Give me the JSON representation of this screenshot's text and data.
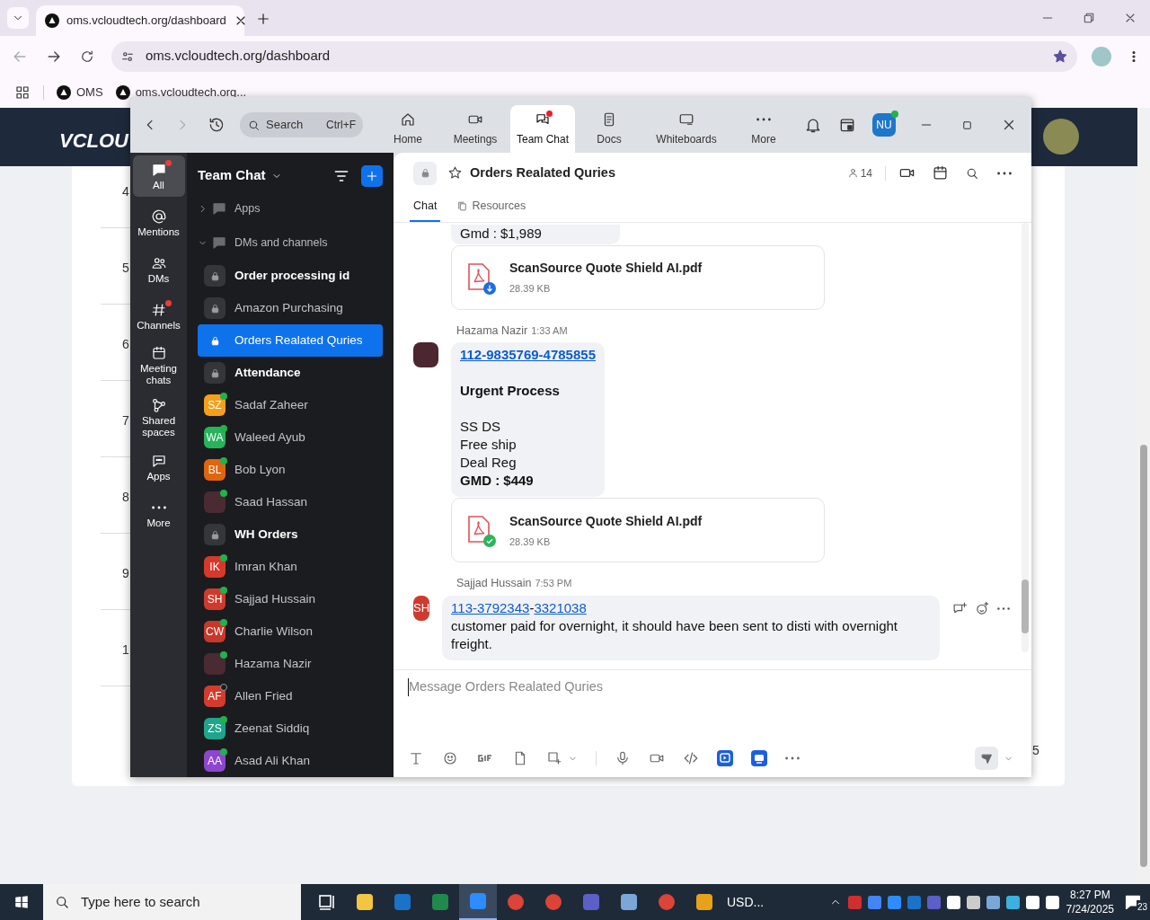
{
  "browser": {
    "tabs": [
      {
        "title": "oms.vcloudtech.org/dashboard",
        "selected": true
      }
    ],
    "address": "oms.vcloudtech.org/dashboard",
    "bookmarks": [
      "OMS",
      "oms.vcloudtech.org..."
    ]
  },
  "page": {
    "logo": "VCLOU",
    "row_numbers": [
      "4",
      "5",
      "6",
      "7",
      "8",
      "9",
      "1"
    ],
    "corner_text": "5"
  },
  "zoom": {
    "search": {
      "placeholder": "Search",
      "shortcut": "Ctrl+F"
    },
    "nav_tabs": [
      {
        "label": "Home",
        "selected": false,
        "badge": false
      },
      {
        "label": "Meetings",
        "selected": false,
        "badge": false
      },
      {
        "label": "Team Chat",
        "selected": true,
        "badge": true
      },
      {
        "label": "Docs",
        "selected": false,
        "badge": false
      },
      {
        "label": "Whiteboards",
        "selected": false,
        "badge": false
      },
      {
        "label": "More",
        "selected": false,
        "badge": false
      }
    ],
    "profile_initials": "NU",
    "rail": [
      {
        "label": "All",
        "selected": true,
        "badge": true
      },
      {
        "label": "Mentions",
        "selected": false,
        "badge": false
      },
      {
        "label": "DMs",
        "selected": false,
        "badge": false
      },
      {
        "label": "Channels",
        "selected": false,
        "badge": true
      },
      {
        "label": "Meeting chats",
        "selected": false,
        "badge": false
      },
      {
        "label": "Shared spaces",
        "selected": false,
        "badge": false
      },
      {
        "label": "Apps",
        "selected": false,
        "badge": false
      },
      {
        "label": "More",
        "selected": false,
        "badge": false
      }
    ],
    "sidebar": {
      "title": "Team Chat",
      "sections": [
        {
          "label": "Apps",
          "expanded": false
        },
        {
          "label": "DMs and channels",
          "expanded": true,
          "children": [
            {
              "kind": "channel",
              "name": "Order processing id",
              "unread": true,
              "selected": false
            },
            {
              "kind": "channel",
              "name": "Amazon Purchasing",
              "unread": false,
              "selected": false
            },
            {
              "kind": "channel",
              "name": "Orders Realated Quries",
              "unread": false,
              "selected": true
            },
            {
              "kind": "channel",
              "name": "Attendance",
              "unread": true,
              "selected": false
            },
            {
              "kind": "person",
              "name": "Sadaf Zaheer",
              "initials": "SZ",
              "color": "#f5a01a",
              "online": true,
              "selected": false
            },
            {
              "kind": "person",
              "name": "Waleed Ayub",
              "initials": "WA",
              "color": "#27b35a",
              "online": true,
              "selected": false
            },
            {
              "kind": "person",
              "name": "Bob Lyon",
              "initials": "BL",
              "color": "#e0650f",
              "online": true,
              "selected": false
            },
            {
              "kind": "photo_person",
              "name": "Saad Hassan",
              "online": true,
              "selected": false
            },
            {
              "kind": "channel",
              "name": "WH Orders",
              "unread": true,
              "selected": false
            },
            {
              "kind": "person",
              "name": "Imran Khan",
              "initials": "IK",
              "color": "#d6392c",
              "online": true,
              "selected": false
            },
            {
              "kind": "person",
              "name": "Sajjad Hussain",
              "initials": "SH",
              "color": "#cf3a2e",
              "online": true,
              "selected": false
            },
            {
              "kind": "person",
              "name": "Charlie Wilson",
              "initials": "CW",
              "color": "#c9372b",
              "online": true,
              "selected": false
            },
            {
              "kind": "photo_person",
              "name": "Hazama Nazir",
              "online": true,
              "selected": false
            },
            {
              "kind": "person",
              "name": "Allen Fried",
              "initials": "AF",
              "color": "#d33b2d",
              "online": false,
              "selected": false
            },
            {
              "kind": "person",
              "name": "Zeenat Siddiq",
              "initials": "ZS",
              "color": "#1fa58c",
              "online": true,
              "selected": false
            },
            {
              "kind": "person",
              "name": "Asad Ali Khan",
              "initials": "AA",
              "color": "#8e46cf",
              "online": true,
              "selected": false
            }
          ]
        }
      ]
    },
    "chat": {
      "title": "Orders Realated Quries",
      "member_count": "14",
      "tabs": [
        {
          "label": "Chat",
          "selected": true
        },
        {
          "label": "Resources",
          "selected": false
        }
      ],
      "messages": [
        {
          "kind": "fragment",
          "lines": [
            {
              "kind": "text",
              "text": "Gmd : $1,989",
              "bold": false
            }
          ]
        },
        {
          "kind": "file",
          "name": "ScanSource Quote Shield AI.pdf",
          "size": "28.39 KB",
          "downloaded": false
        },
        {
          "kind": "message",
          "sender": "Hazama Nazir",
          "time": "1:33 AM",
          "avatar": {
            "kind": "photo"
          },
          "hover_actions": false,
          "lines": [
            {
              "kind": "link",
              "text": "112-9835769-4785855",
              "bold": true
            },
            {
              "kind": "gap"
            },
            {
              "kind": "text",
              "text": "Urgent Process",
              "bold": true
            },
            {
              "kind": "gap"
            },
            {
              "kind": "text",
              "text": "SS DS",
              "bold": false
            },
            {
              "kind": "text",
              "text": "Free ship",
              "bold": false
            },
            {
              "kind": "text",
              "text": "Deal Reg",
              "bold": false
            },
            {
              "kind": "text",
              "text": "GMD : $449",
              "bold": true
            }
          ]
        },
        {
          "kind": "file",
          "name": "ScanSource Quote Shield AI.pdf",
          "size": "28.39 KB",
          "downloaded": true
        },
        {
          "kind": "message",
          "sender": "Sajjad Hussain",
          "time": "7:53 PM",
          "avatar": {
            "kind": "initials",
            "initials": "SH",
            "color": "#cf3a2e"
          },
          "hover_actions": true,
          "lines": [
            {
              "kind": "links",
              "parts": [
                {
                  "text": "113-3792343",
                  "link": true
                },
                {
                  "text": "-",
                  "link": false
                },
                {
                  "text": "3321038",
                  "link": true
                }
              ]
            },
            {
              "kind": "text",
              "text": "customer paid for overnight, it should have been sent to disti with overnight freight.",
              "bold": false
            }
          ]
        }
      ],
      "composer": {
        "placeholder": "Message Orders Realated Quries"
      }
    }
  },
  "taskbar": {
    "search_placeholder": "Type here to search",
    "app_label": "USD...",
    "time": "8:27 PM",
    "date": "7/24/2025",
    "notification_count": "23"
  }
}
